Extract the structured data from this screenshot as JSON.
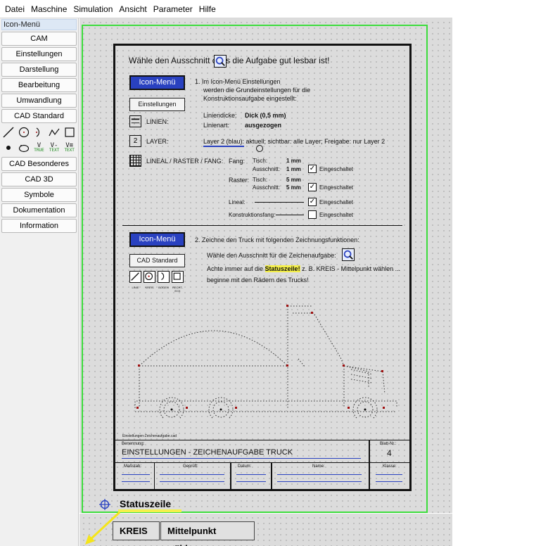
{
  "menubar": {
    "items": [
      "Datei",
      "Maschine",
      "Simulation",
      "Ansicht",
      "Parameter",
      "Hilfe"
    ]
  },
  "sidebar": {
    "title": "Icon-Menü",
    "buttons": [
      "CAM",
      "Einstellungen",
      "Darstellung",
      "Bearbeitung",
      "Umwandlung",
      "CAD Standard"
    ],
    "buttons2": [
      "CAD Besonderes",
      "CAD 3D",
      "Symbole",
      "Dokumentation",
      "Information"
    ],
    "tool_labels": [
      "TRUE",
      "TEXT",
      "TEXT"
    ]
  },
  "sheet": {
    "instruction": "Wähle den Ausschnitt    dass die Aufgabe gut lesbar ist!",
    "icon_menu_label": "Icon-Menü",
    "einstellungen_btn": "Einstellungen",
    "step1_line1": "1. Im Icon-Menü Einstellungen",
    "step1_line2": "werden die Grundeinstellungen für die",
    "step1_line3": "Konstruktionsaufgabe eingestellt:",
    "linien_label": "LINIEN:",
    "liniendicke_label": "Liniendicke:",
    "liniendicke_value": "Dick  (0,5 mm)",
    "linienart_label": "Linienart:",
    "linienart_value": "ausgezogen",
    "layer_num": "2",
    "layer_label": "LAYER:",
    "layer_value": "Layer 2 (blau): aktuell;  sichtbar: alle Layer;  Freigabe: nur Layer 2",
    "lineal_label": "LINEAL / RASTER / FANG:",
    "fang_label": "Fang:",
    "raster_label": "Raster:",
    "tisch_label": "Tisch:",
    "ausschnitt_label": "Ausschnitt:",
    "fang_tisch": "1 mm",
    "fang_ausschnitt": "1 mm",
    "raster_tisch": "5 mm",
    "raster_ausschnitt": "5 mm",
    "eingeschaltet": "Eingeschaltet",
    "lineal_row": "Lineal:",
    "konstruktionsfang_row": "Konstruktionsfang:",
    "icon_menu_label2": "Icon-Menü",
    "cad_standard_btn": "CAD Standard",
    "step2": "2. Zeichne den Truck mit folgenden Zeichnungsfunktionen:",
    "bullet1": "Wähle den Ausschnitt für die Zeichenaufgabe:",
    "bullet2_pre": "Achte immer auf die ",
    "bullet2_hl": "Statuszeile!",
    "bullet2_post": " z. B. KREIS - Mittelpunkt wählen ...",
    "bullet3": "beginne mit den Rädern des Trucks!",
    "mini_icon_labels": [
      "LINIE",
      "KREIS",
      "BOGEN",
      "RECHT-ECK"
    ],
    "filename": "Einstellungen-Zeichenaufgabe.cad",
    "benennung_label": "Benennung:",
    "benennung_value": "EINSTELLUNGEN - ZEICHENAUFGABE TRUCK",
    "blatt_label": "Blatt-Nr.:",
    "blatt_value": "4",
    "massstab_label": "Maßstab:",
    "geprueft_label": "Geprüft:",
    "datum_label": "Datum:",
    "name_label": "Name:",
    "klasse_label": "Klasse:"
  },
  "status": {
    "label": "Statuszeile",
    "kreis_btn": "KREIS",
    "mittelpunkt_btn": "Mittelpunkt wählen"
  },
  "colors": {
    "canvas": "#dcdcdc",
    "green_frame": "#3cdc3c",
    "blue_box": "#2941c0",
    "highlight": "#f5f04a",
    "marker": "#a01010"
  }
}
